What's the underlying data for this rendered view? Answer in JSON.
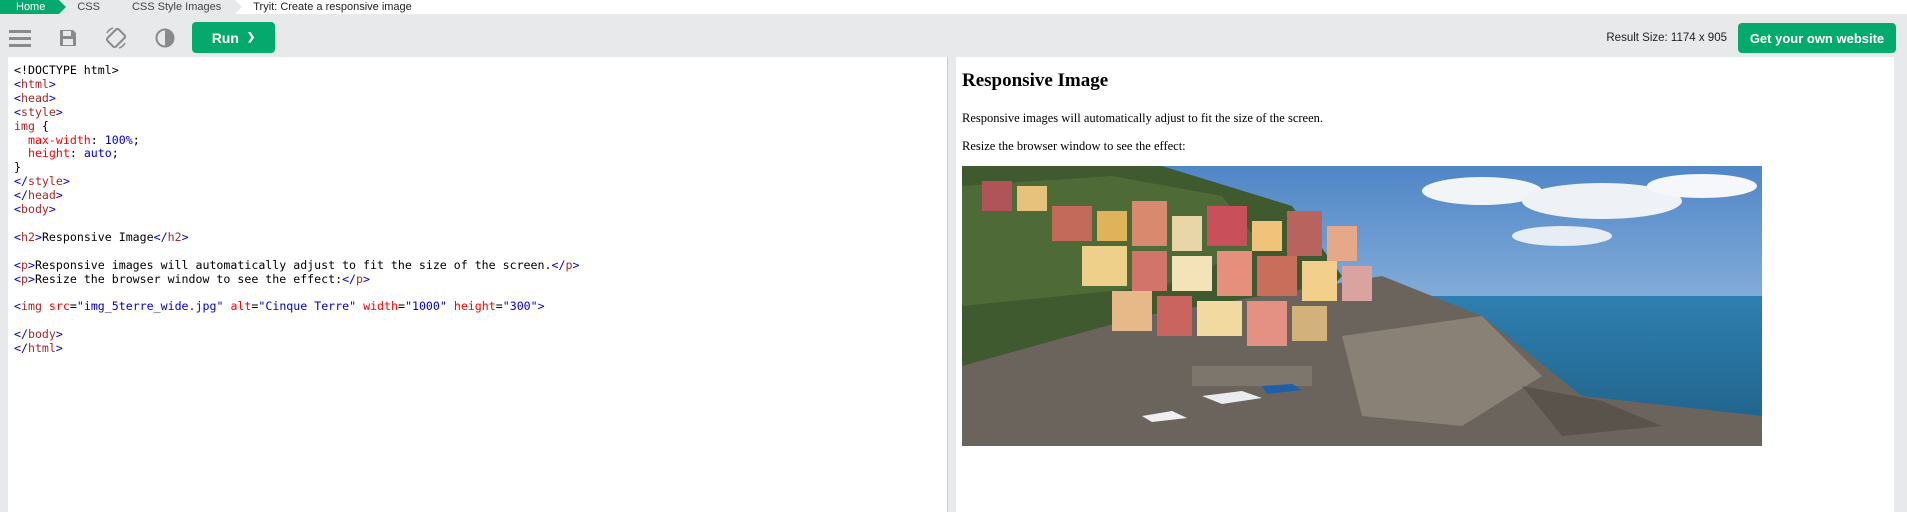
{
  "breadcrumb": [
    {
      "label": "Home"
    },
    {
      "label": "CSS"
    },
    {
      "label": "CSS Style Images"
    },
    {
      "label": "Tryit: Create a responsive image"
    }
  ],
  "toolbar": {
    "icons": [
      "menu-icon",
      "save-icon",
      "rotate-icon",
      "contrast-icon"
    ],
    "run_label": "Run",
    "run_chevron": "❯",
    "result_size": "Result Size: 1174 x 905",
    "own_website_label": "Get your own website"
  },
  "editor": {
    "lines": [
      "<!DOCTYPE html>",
      "<html>",
      "<head>",
      "<style>",
      "img {",
      "  max-width: 100%;",
      "  height: auto;",
      "}",
      "</style>",
      "</head>",
      "<body>",
      "",
      "<h2>Responsive Image</h2>",
      "",
      "<p>Responsive images will automatically adjust to fit the size of the screen.</p>",
      "<p>Resize the browser window to see the effect:</p>",
      "",
      "<img src=\"img_5terre_wide.jpg\" alt=\"Cinque Terre\" width=\"1000\" height=\"300\">",
      "",
      "</body>",
      "</html>"
    ]
  },
  "result": {
    "heading": "Responsive Image",
    "p1": "Responsive images will automatically adjust to fit the size of the screen.",
    "p2": "Resize the browser window to see the effect:",
    "image_alt": "Cinque Terre"
  },
  "colors": {
    "accent": "#04aa6d",
    "tag": "#0000cd",
    "tagname": "#a52a2a",
    "attr": "#ff0000"
  }
}
